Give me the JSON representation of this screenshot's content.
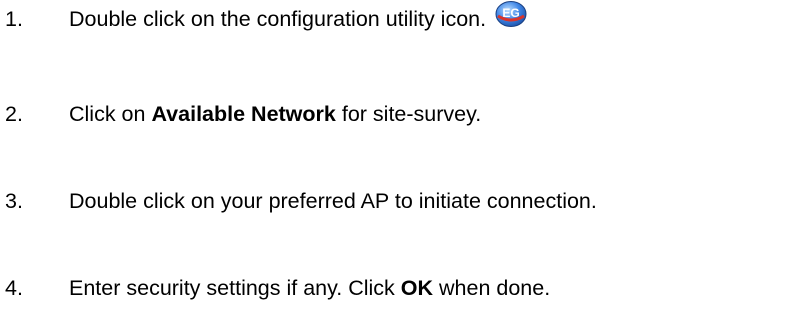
{
  "steps": [
    {
      "number": "1.",
      "text": "Double click on the configuration utility icon.",
      "icon": "configuration-utility-icon",
      "icon_text": "EG"
    },
    {
      "number": "2.",
      "text_before": "Click on ",
      "bold": "Available Network",
      "text_after": " for site-survey."
    },
    {
      "number": "3.",
      "text": "Double click on your preferred AP to initiate connection."
    },
    {
      "number": "4.",
      "text_before": "Enter security settings if any. Click ",
      "bold": "OK",
      "text_after": " when done."
    }
  ],
  "colors": {
    "text": "#000000",
    "icon_blue": "#2f6fd6",
    "icon_red": "#d9342b"
  }
}
